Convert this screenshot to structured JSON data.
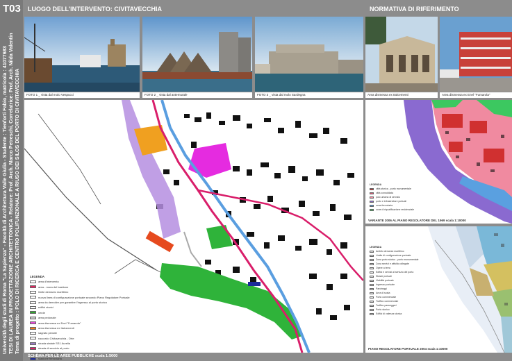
{
  "code": "T03",
  "sidebar_lines": [
    "Università degli studi di Roma \"La Sapienza\" - Facoltà di Architettura Valle Giulia - Studente : Tienforti Fabio, matricola : 41077683",
    "TESI DI LAUREA IN PROGETTAZIONE ARCHITETTONICA - Relatore: Prof. Arch. Marco Petreschi, Correlatrice: Prof. Arch. Nilda Valentin",
    "Tema di progetto : POLO DI RICERCA E CENTRO POLIFUNZIONALE A RIUSO DEI SILOS DEL PORTO DI CIVITAVECCHIA"
  ],
  "header_left": "LUOGO DELL'INTERVENTO: CIVITAVECCHIA",
  "header_right": "NORMATIVA DI RIFERIMENTO",
  "photos": [
    {
      "caption": "FOTO 1 _ vista dal molo Vespucci"
    },
    {
      "caption": "FOTO 2 _ vista dal antemurale"
    },
    {
      "caption": "FOTO 3 _ vista dal molo Sardegna"
    },
    {
      "caption": "Area dismessa ex Italcementi"
    },
    {
      "caption": "Area dismessa ex Enel \"Fumarola\""
    }
  ],
  "map_legend": {
    "title": "LEGENDA",
    "items": [
      {
        "label": "area d'intervento",
        "color": "#ffffff"
      },
      {
        "label": "area - mura del bastione",
        "color": "#e0245e"
      },
      {
        "label": "limite demanio marittimo",
        "color": "#ffffff"
      },
      {
        "label": "nuova linea di configurazione portuale secondo Piano Regolatore Portuale",
        "color": "#ffffff"
      },
      {
        "label": "area da demolire per garantire l'ingresso al porto storico",
        "color": "#ffffff"
      },
      {
        "label": "edifici storici",
        "color": "#ffffff"
      },
      {
        "label": "verde",
        "color": "#30a830"
      },
      {
        "label": "area pedonale",
        "color": "#c8c8c8"
      },
      {
        "label": "area dismessa ex Enel \"Fumarola\"",
        "color": "#e64ad8"
      },
      {
        "label": "area dismessa ex Italcementi",
        "color": "#f07a1e"
      },
      {
        "label": "sagrato pensile",
        "color": "#ffffff"
      },
      {
        "label": "raccordo Civitavecchia - Orte",
        "color": "#ffffff"
      },
      {
        "label": "strada statale SS1 Aurelia",
        "color": "#9a7bc4"
      },
      {
        "label": "strada di servizio al porto",
        "color": "#e01e6a"
      },
      {
        "label": "ferrovia Roma - Pisa",
        "color": "#7a7a7a"
      },
      {
        "label": "stazione ferroviaria",
        "color": "#1c2a9a"
      }
    ]
  },
  "map_footer": "SCHEMA PER LE AREE PUBBLICHE scala 1:5000",
  "prg_legend": {
    "title": "LEGENDA",
    "items": [
      {
        "label": "città storica - porto monumentale",
        "color": "#d03030"
      },
      {
        "label": "città consolidata",
        "color": "#e05a7a"
      },
      {
        "label": "polo urbano di servizio",
        "color": "#f08aa0"
      },
      {
        "label": "porto e infrastrutture portuali",
        "color": "#8a6ad0"
      },
      {
        "label": "zona ferroviaria",
        "color": "#5aa0e0"
      },
      {
        "label": "zone di riqualificazione residenziale",
        "color": "#3cc860"
      }
    ]
  },
  "prg_caption": "VARIANTE 2006 AL PIANO REGOLATORE DEL 1969 scala 1:10000",
  "prp_legend": {
    "title": "LEGENDA",
    "items": [
      "Ambito demanio marittimo",
      "Limite di configurazione portuale",
      "Zona porto storico - porto monumentale",
      "Zona servizi e attività collegate",
      "Opere a terra",
      "Edifici e servizi al servizio del porto",
      "Strade portuali",
      "Viabilità portuale",
      "Ingresso portuale",
      "Parcheggi",
      "Area di sosta",
      "Porto commerciale",
      "Traffico commerciale",
      "Traffico passeggeri",
      "Porto storico",
      "Edifici di valenza storica"
    ]
  },
  "prp_caption": "PIANO REGOLATORE PORTUALE 2004 scala 1:10000"
}
